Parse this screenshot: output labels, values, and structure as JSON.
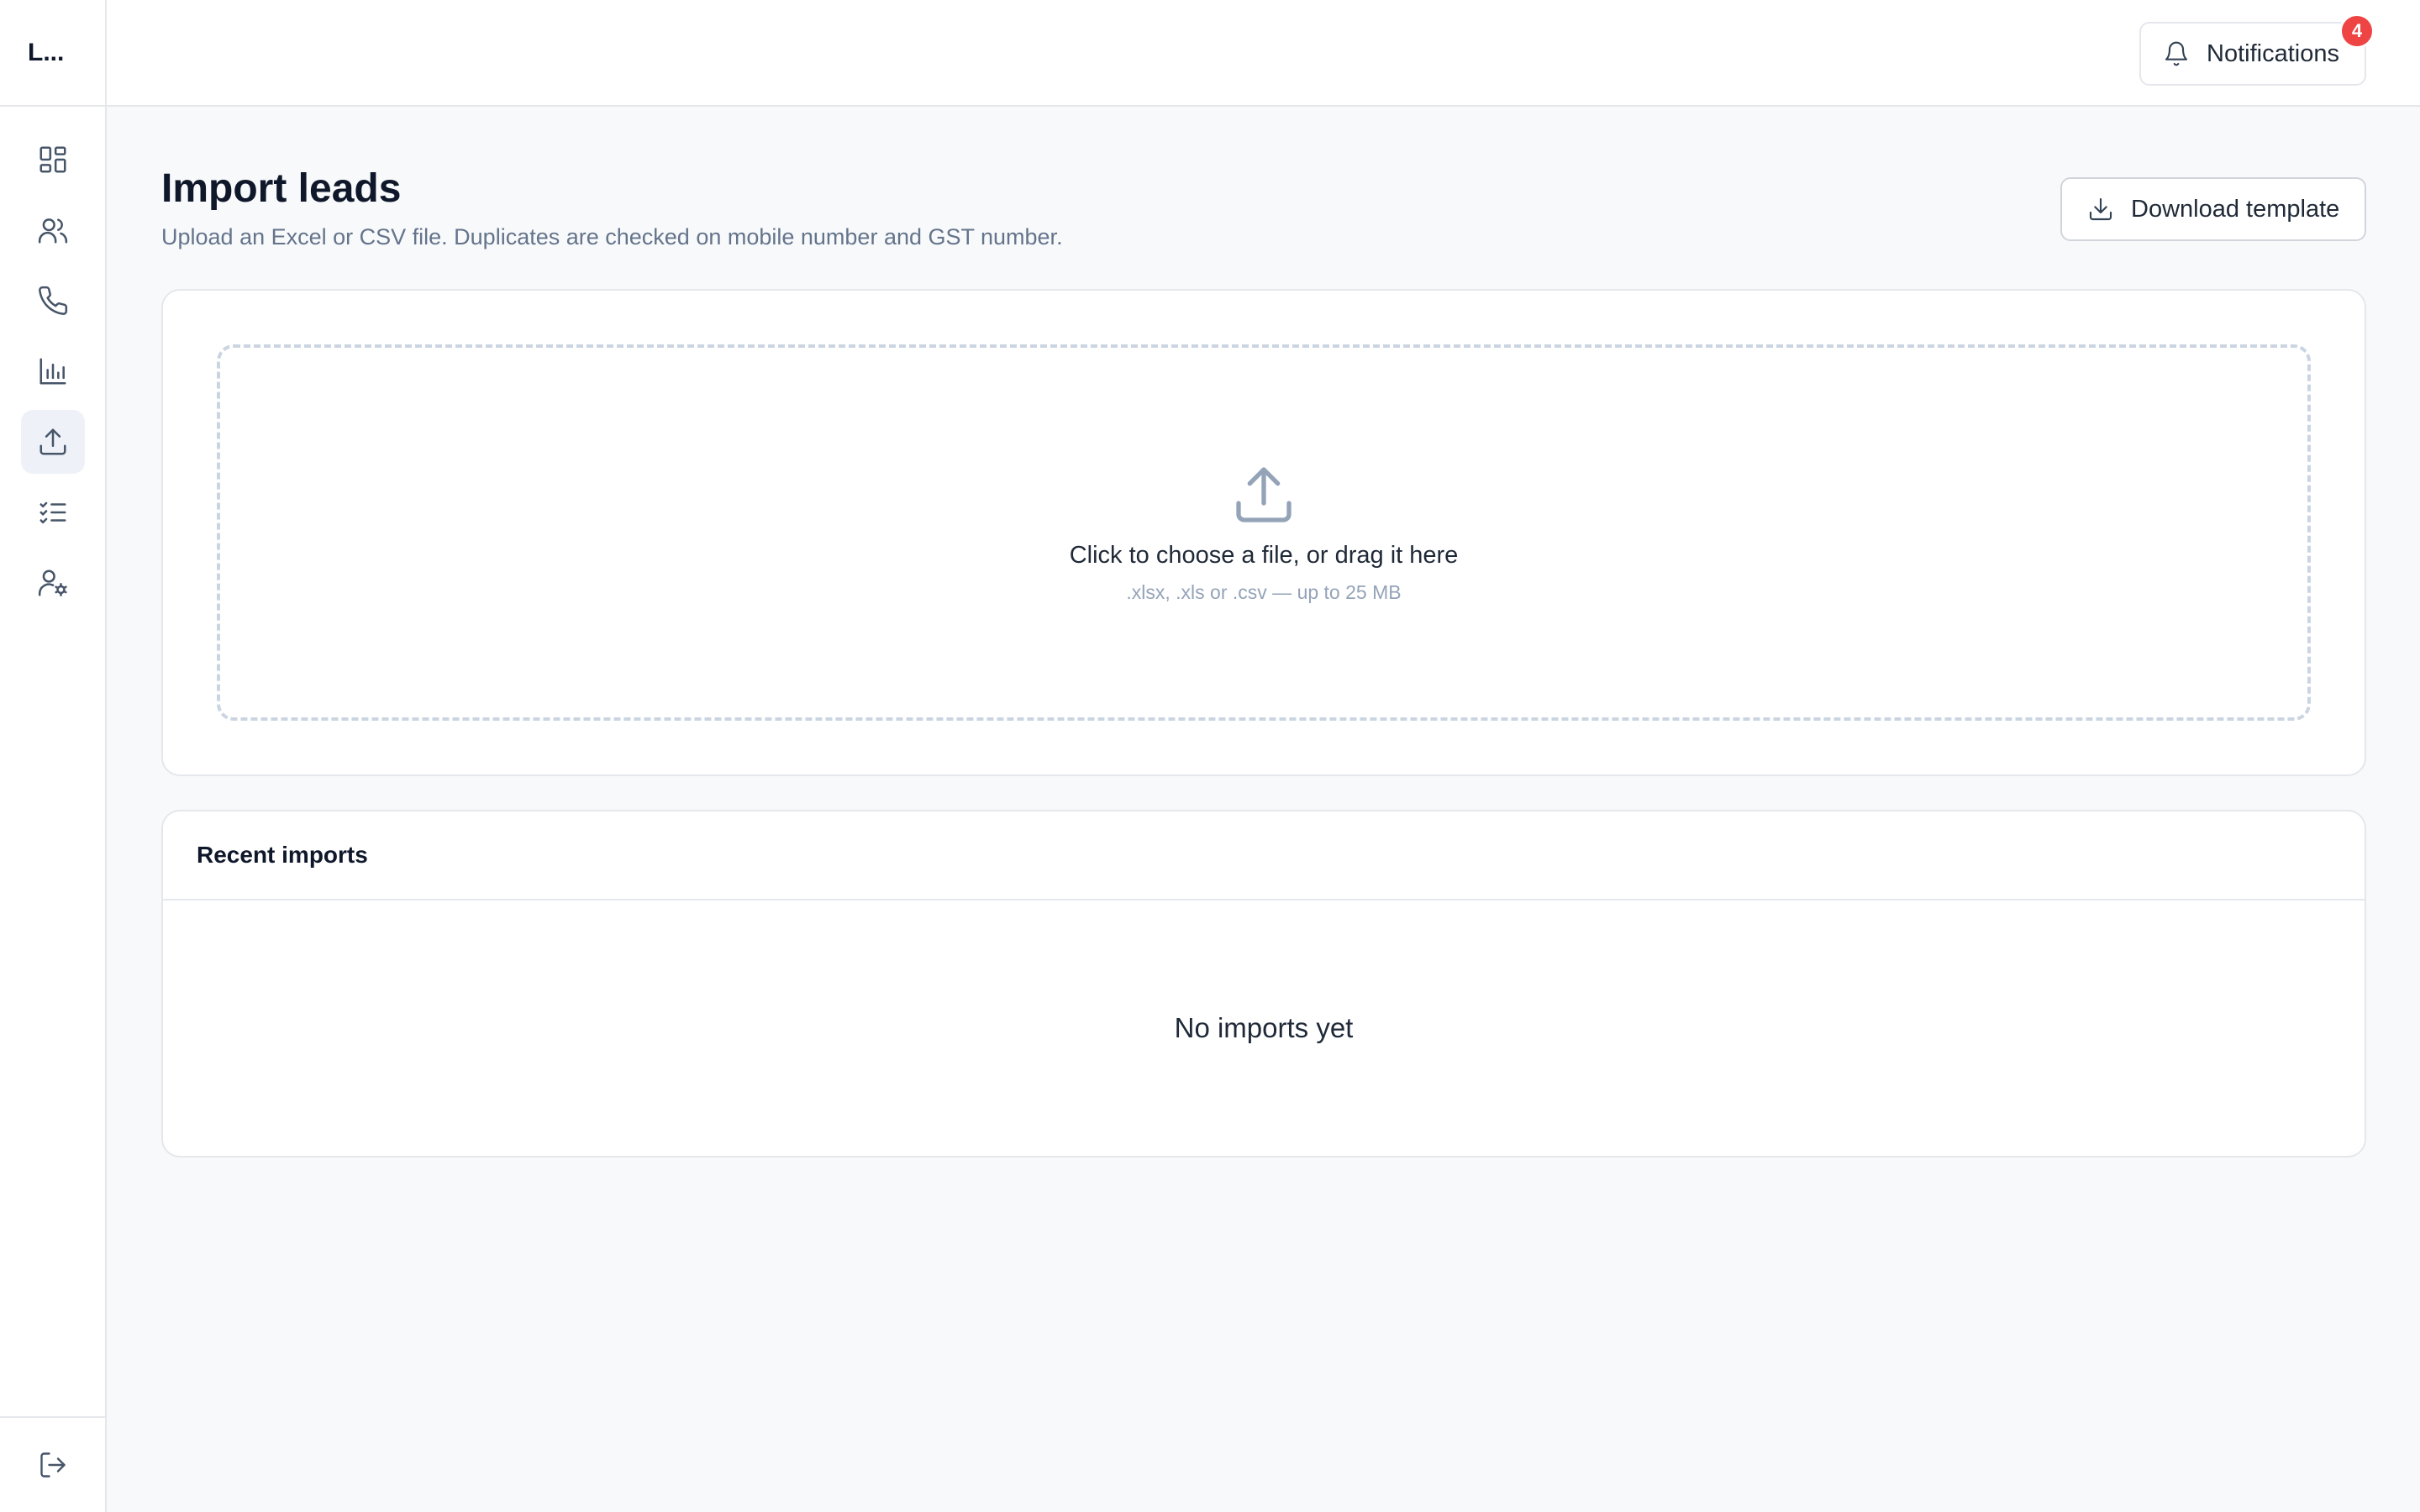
{
  "sidebar": {
    "brand": "L...",
    "items": [
      {
        "name": "dashboard",
        "icon": "grid-icon",
        "active": false
      },
      {
        "name": "leads",
        "icon": "users-icon",
        "active": false
      },
      {
        "name": "calls",
        "icon": "phone-icon",
        "active": false
      },
      {
        "name": "reports",
        "icon": "bar-chart-icon",
        "active": false
      },
      {
        "name": "import",
        "icon": "upload-icon",
        "active": true
      },
      {
        "name": "tasks",
        "icon": "checklist-icon",
        "active": false
      },
      {
        "name": "user-settings",
        "icon": "user-gear-icon",
        "active": false
      }
    ],
    "logout_icon": "logout-icon"
  },
  "header": {
    "notifications_label": "Notifications",
    "notifications_count": "4"
  },
  "page": {
    "title": "Import leads",
    "subtitle": "Upload an Excel or CSV file. Duplicates are checked on mobile number and GST number.",
    "download_label": "Download template"
  },
  "upload": {
    "title": "Click to choose a file, or drag it here",
    "hint": ".xlsx, .xls or .csv — up to 25 MB"
  },
  "recent": {
    "title": "Recent imports",
    "empty": "No imports yet"
  },
  "colors": {
    "accent_badge": "#ef4444",
    "active_nav_bg": "#eef2f8",
    "border": "#e5e7eb"
  }
}
